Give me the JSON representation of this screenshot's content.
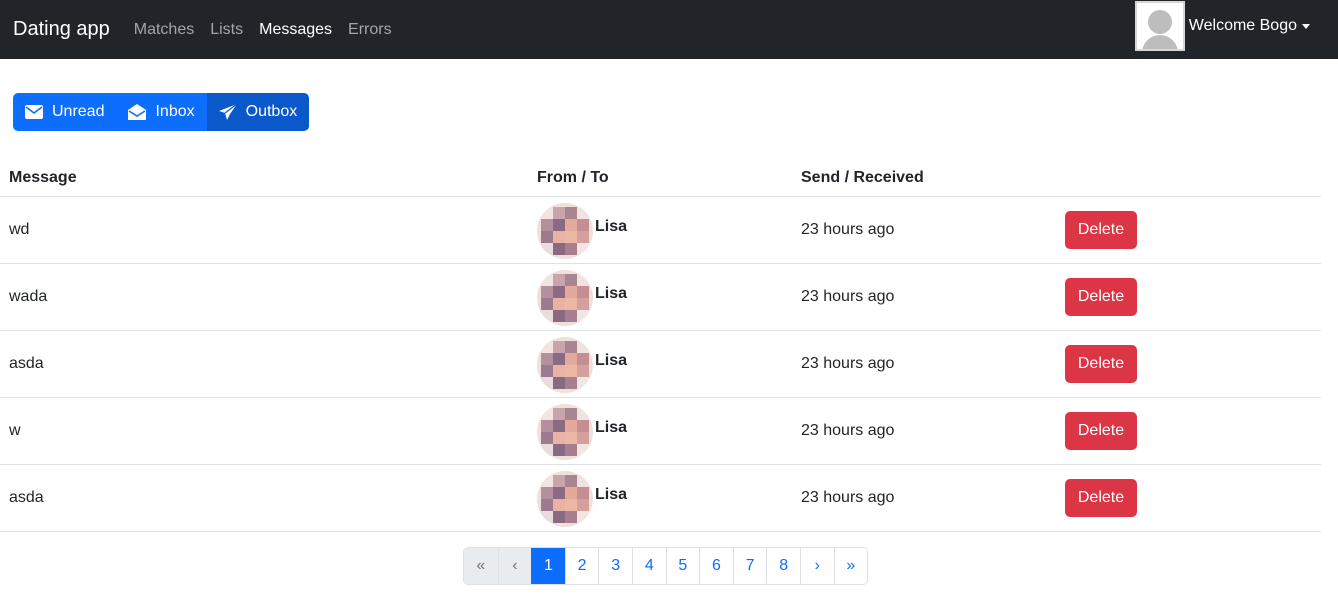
{
  "navbar": {
    "brand": "Dating app",
    "links": [
      {
        "label": "Matches",
        "active": false
      },
      {
        "label": "Lists",
        "active": false
      },
      {
        "label": "Messages",
        "active": true
      },
      {
        "label": "Errors",
        "active": false
      }
    ],
    "user": {
      "welcome": "Welcome Bogo"
    }
  },
  "tabs": {
    "unread": "Unread",
    "inbox": "Inbox",
    "outbox": "Outbox",
    "active": "Outbox"
  },
  "table": {
    "headers": {
      "message": "Message",
      "from_to": "From / To",
      "date": "Send / Received"
    },
    "rows": [
      {
        "message": "wd",
        "name": "Lisa",
        "date": "23 hours ago",
        "action": "Delete"
      },
      {
        "message": "wada",
        "name": "Lisa",
        "date": "23 hours ago",
        "action": "Delete"
      },
      {
        "message": "asda",
        "name": "Lisa",
        "date": "23 hours ago",
        "action": "Delete"
      },
      {
        "message": "w",
        "name": "Lisa",
        "date": "23 hours ago",
        "action": "Delete"
      },
      {
        "message": "asda",
        "name": "Lisa",
        "date": "23 hours ago",
        "action": "Delete"
      }
    ]
  },
  "pagination": {
    "first": "«",
    "prev": "‹",
    "pages": [
      "1",
      "2",
      "3",
      "4",
      "5",
      "6",
      "7",
      "8"
    ],
    "next": "›",
    "last": "»",
    "current": "1"
  },
  "colors": {
    "navbar_bg": "#212529",
    "primary": "#0d6efd",
    "primary_active": "#0a58ca",
    "danger": "#dc3545",
    "border": "#dee2e6"
  }
}
